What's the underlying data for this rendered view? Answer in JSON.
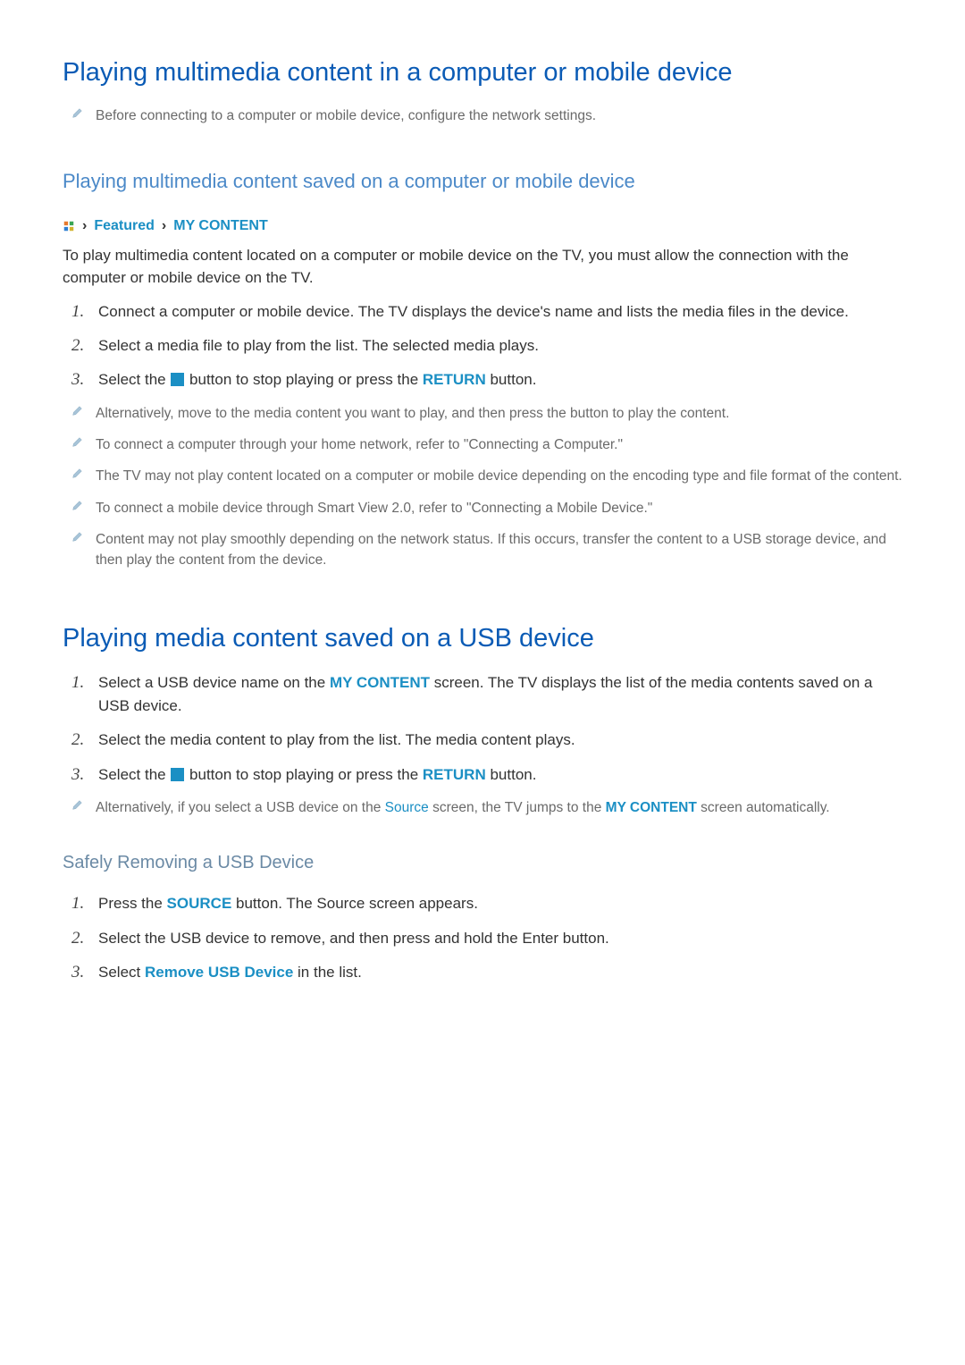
{
  "section1": {
    "title": "Playing multimedia content in a computer or mobile device",
    "note_intro": "Before connecting to a computer or mobile device, configure the network settings.",
    "sub_title": "Playing multimedia content saved on a computer or mobile device",
    "breadcrumb": {
      "part1": "Featured",
      "part2": "MY CONTENT"
    },
    "intro_para": "To play multimedia content located on a computer or mobile device on the TV, you must allow the connection with the computer or mobile device on the TV.",
    "steps": [
      "Connect a computer or mobile device. The TV displays the device's name and lists the media files in the device.",
      "Select a media file to play from the list. The selected media plays."
    ],
    "step3_pre": "Select the ",
    "step3_mid": " button to stop playing or press the ",
    "step3_kw": "RETURN",
    "step3_post": " button.",
    "notes": [
      "Alternatively, move to the media content you want to play, and then press the     button to play the content.",
      "To connect a computer through your home network, refer to \"Connecting a Computer.\"",
      "The TV may not play content located on a computer or mobile device depending on the encoding type and file format of the content.",
      "To connect a mobile device through Smart View 2.0, refer to \"Connecting a Mobile Device.\"",
      "Content may not play smoothly depending on the network status. If this occurs, transfer the content to a USB storage device, and then play the content from the device."
    ]
  },
  "section2": {
    "title": "Playing media content saved on a USB device",
    "step1_pre": "Select a USB device name on the ",
    "step1_kw": "MY CONTENT",
    "step1_post": " screen. The TV displays the list of the media contents saved on a USB device.",
    "step2": "Select the media content to play from the list. The media content plays.",
    "step3_pre": "Select the ",
    "step3_mid": " button to stop playing or press the ",
    "step3_kw": "RETURN",
    "step3_post": " button.",
    "note_pre": "Alternatively, if you select a USB device on the ",
    "note_kw1": "Source",
    "note_mid": " screen, the TV jumps to the ",
    "note_kw2": "MY CONTENT",
    "note_post": " screen automatically."
  },
  "section3": {
    "title": "Safely Removing a USB Device",
    "step1_pre": "Press the ",
    "step1_kw": "SOURCE",
    "step1_post": " button. The Source screen appears.",
    "step2": "Select the USB device to remove, and then press and hold the Enter button.",
    "step3_pre": "Select ",
    "step3_kw": "Remove USB Device",
    "step3_post": " in the list."
  }
}
